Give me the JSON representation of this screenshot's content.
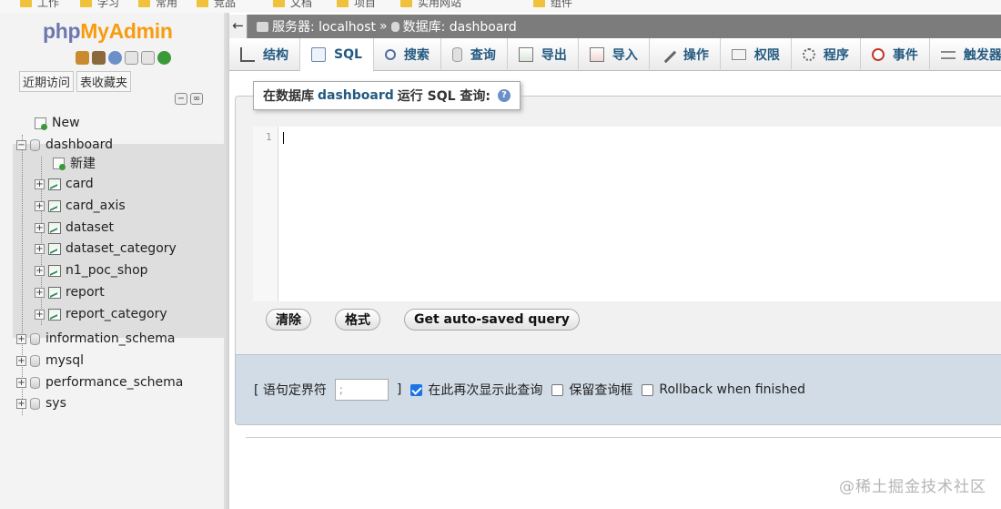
{
  "bookmarks": [
    "工作",
    "学习",
    "常用",
    "竞品",
    "文档",
    "项目",
    "实用网站",
    "组件"
  ],
  "sidebar": {
    "logo": {
      "part1": "php",
      "part2": "MyAdmin"
    },
    "quick_links": [
      "近期访问",
      "表收藏夹"
    ],
    "tree": {
      "new_label": "New",
      "databases_top": [
        "dashboard"
      ],
      "dashboard_children": {
        "new_label": "新建",
        "tables": [
          "card",
          "card_axis",
          "dataset",
          "dataset_category",
          "n1_poc_shop",
          "report",
          "report_category"
        ]
      },
      "databases_rest": [
        "information_schema",
        "mysql",
        "performance_schema",
        "sys"
      ]
    }
  },
  "breadcrumb": {
    "server": "服务器: localhost",
    "separator": "»",
    "database": "数据库: dashboard"
  },
  "tabs": [
    {
      "label": "结构",
      "icon": "structure-icon"
    },
    {
      "label": "SQL",
      "icon": "sql-icon",
      "active": true
    },
    {
      "label": "搜索",
      "icon": "search-icon"
    },
    {
      "label": "查询",
      "icon": "query-icon"
    },
    {
      "label": "导出",
      "icon": "export-icon"
    },
    {
      "label": "导入",
      "icon": "import-icon"
    },
    {
      "label": "操作",
      "icon": "wrench-icon"
    },
    {
      "label": "权限",
      "icon": "privileges-icon"
    },
    {
      "label": "程序",
      "icon": "routines-icon"
    },
    {
      "label": "事件",
      "icon": "clock-icon"
    },
    {
      "label": "触发器",
      "icon": "trigger-icon"
    }
  ],
  "sql_panel": {
    "legend_prefix": "在数据库",
    "legend_db": "dashboard",
    "legend_suffix": "运行 SQL 查询:",
    "line_number": "1"
  },
  "buttons": {
    "clear": "清除",
    "format": "格式",
    "auto_saved": "Get auto-saved query"
  },
  "options": {
    "delimiter_label_open": "[ 语句定界符",
    "delimiter_value": ";",
    "delimiter_label_close": "]",
    "show_again_label": "在此再次显示此查询",
    "keep_box_label": "保留查询框",
    "rollback_label": "Rollback when finished"
  },
  "watermark": "@稀土掘金技术社区"
}
